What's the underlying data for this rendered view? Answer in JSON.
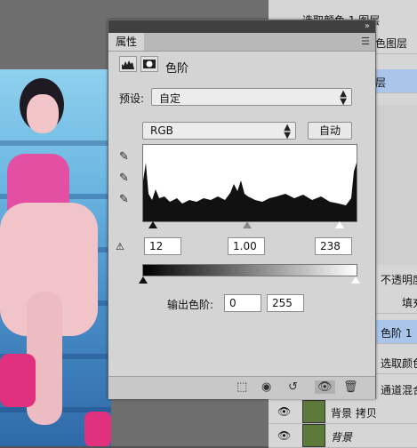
{
  "properties_panel": {
    "tab_label": "属性",
    "adjustment_title": "色阶",
    "preset_label": "预设:",
    "preset_value": "自定",
    "channel_value": "RGB",
    "auto_button": "自动",
    "input_black": "12",
    "input_gamma": "1.00",
    "input_white": "238",
    "output_label": "输出色阶:",
    "output_black": "0",
    "output_white": "255",
    "collapse_icon": "»",
    "menu_icon": "☰"
  },
  "layers_panel": {
    "items": [
      {
        "label": "选取颜色 1 图层"
      },
      {
        "label": "色图层"
      },
      {
        "label": "层"
      },
      {
        "label": "不透明度"
      },
      {
        "label": "填充"
      },
      {
        "label": "色阶 1"
      },
      {
        "label": "选取颜色"
      },
      {
        "label": "通道混合"
      },
      {
        "label": "背景 拷贝"
      },
      {
        "label": "背景"
      }
    ]
  },
  "colors": {
    "panel_bg": "#d4d4d4",
    "title_bar": "#404040",
    "selected_layer": "#a9c6ea"
  }
}
